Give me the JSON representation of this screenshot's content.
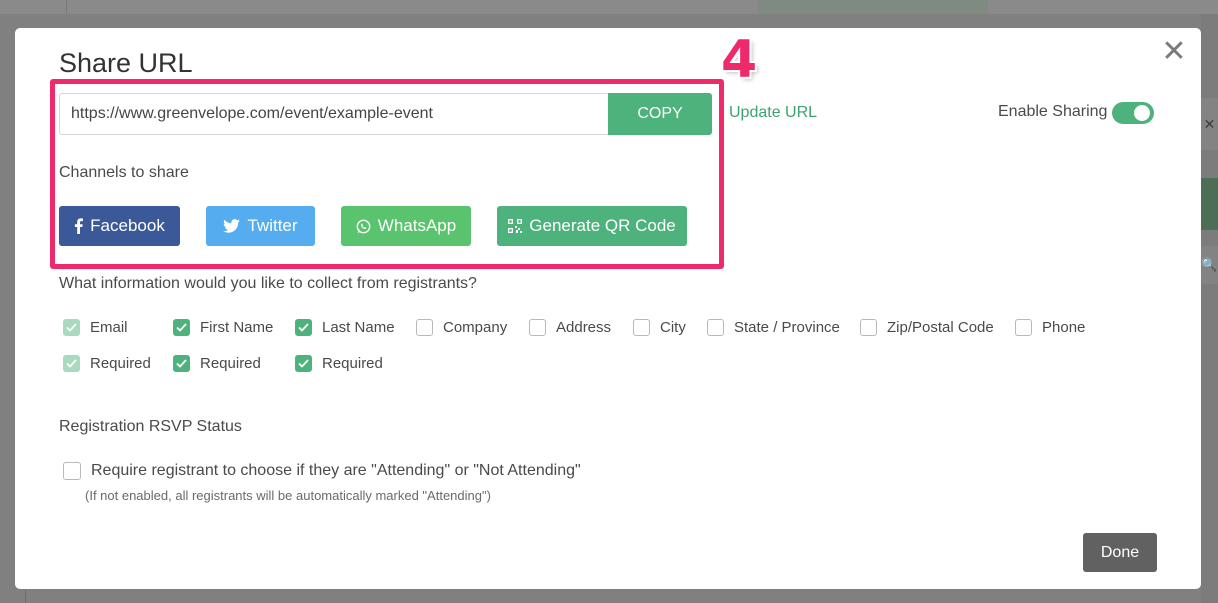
{
  "background": {
    "right_close_glyph": "✕",
    "right_search_glyph": "🔍"
  },
  "modal": {
    "title": "Share URL",
    "close_glyph": "✕",
    "step_number": "4",
    "url_value": "https://www.greenvelope.com/event/example-event",
    "copy_label": "COPY",
    "update_url_label": "Update URL",
    "enable_sharing_label": "Enable Sharing",
    "enable_sharing_on": true,
    "channels_label": "Channels to share",
    "channels": [
      {
        "label": "Facebook",
        "icon": "facebook-icon",
        "color": "#3b5998"
      },
      {
        "label": "Twitter",
        "icon": "twitter-icon",
        "color": "#55acee"
      },
      {
        "label": "WhatsApp",
        "icon": "whatsapp-icon",
        "color": "#59c46d"
      },
      {
        "label": "Generate QR Code",
        "icon": "qr-code-icon",
        "color": "#4db27b"
      }
    ],
    "collect_question": "What information would you like to collect from registrants?",
    "fields": [
      {
        "label": "Email",
        "checked": true,
        "disabled": true,
        "required_label": "Required",
        "required_checked": true,
        "required_disabled": true
      },
      {
        "label": "First Name",
        "checked": true,
        "required_label": "Required",
        "required_checked": true
      },
      {
        "label": "Last Name",
        "checked": true,
        "required_label": "Required",
        "required_checked": true
      },
      {
        "label": "Company",
        "checked": false
      },
      {
        "label": "Address",
        "checked": false
      },
      {
        "label": "City",
        "checked": false
      },
      {
        "label": "State / Province",
        "checked": false
      },
      {
        "label": "Zip/Postal Code",
        "checked": false
      },
      {
        "label": "Phone",
        "checked": false
      }
    ],
    "rsvp_title": "Registration RSVP Status",
    "rsvp_option": "Require registrant to choose if they are \"Attending\" or \"Not Attending\"",
    "rsvp_checked": false,
    "rsvp_note": "(If not enabled, all registrants will be automatically marked \"Attending\")",
    "done_label": "Done"
  },
  "colors": {
    "accent_green": "#4db27b",
    "highlight_pink": "#ee2a6b",
    "done_gray": "#616161"
  }
}
